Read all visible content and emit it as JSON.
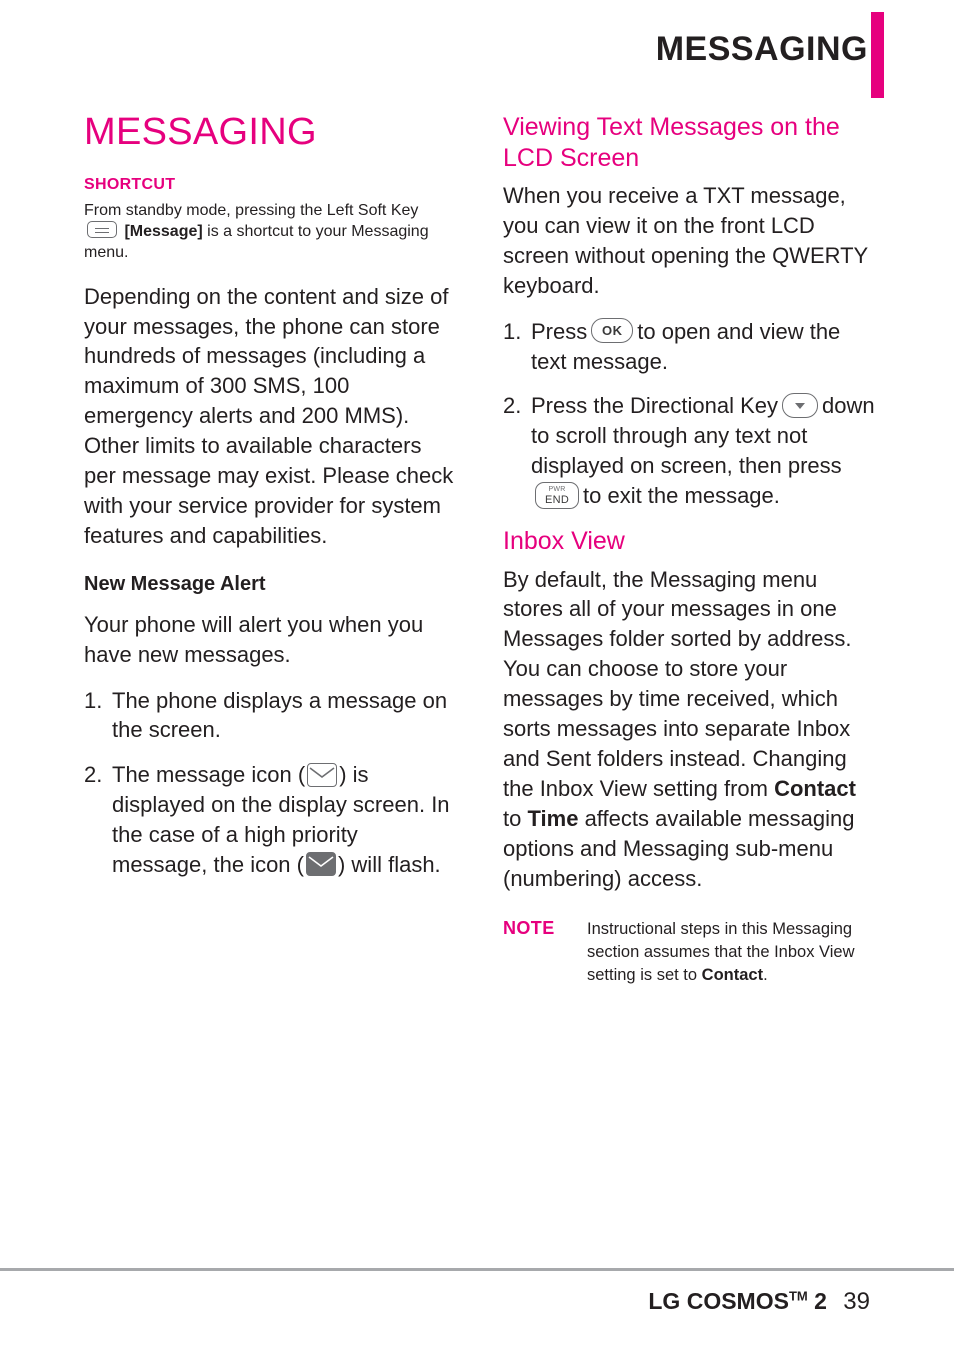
{
  "header": {
    "title": "MESSAGING",
    "accent_color": "#e6007e"
  },
  "left_column": {
    "page_title": "MESSAGING",
    "shortcut_heading": "SHORTCUT",
    "shortcut_text_part1": "From standby mode, pressing the Left Soft Key",
    "shortcut_text_bold": "[Message]",
    "shortcut_text_part2": "is a shortcut to your Messaging menu.",
    "paragraph_capacity": "Depending on the content and size of your messages, the phone can store hundreds of messages (including a maximum of 300 SMS, 100 emergency alerts and 200 MMS). Other limits to available characters per message may exist. Please check with your service provider for system features and capabilities.",
    "alert_heading": "New Message Alert",
    "alert_paragraph": "Your phone will alert you when you have new messages.",
    "steps": [
      {
        "number": "1.",
        "text": "The phone displays a message on the screen."
      },
      {
        "number": "2.",
        "text_part1": "The message icon (",
        "text_part2": ") is displayed on the display screen. In the case of a high priority message, the icon (",
        "text_part3": ") will flash."
      }
    ]
  },
  "right_column": {
    "section1_heading": "Viewing Text Messages on the LCD Screen",
    "section1_paragraph": "When you receive a TXT message, you can view it on the front LCD screen without opening the QWERTY keyboard.",
    "section1_steps": [
      {
        "number": "1.",
        "text_part1": "Press",
        "key_label": "OK",
        "text_part2": "to open and view the text message."
      },
      {
        "number": "2.",
        "text_part1": "Press the Directional Key",
        "text_part2": "down to scroll through any text not displayed on screen, then press",
        "key_line1": "PWR",
        "key_line2": "END",
        "text_part3": "to exit the message."
      }
    ],
    "section2_heading": "Inbox View",
    "section2_paragraph_part1": "By default, the Messaging menu stores all of your messages in one Messages folder sorted by address. You can choose to store your messages by time received, which sorts messages into separate Inbox and Sent folders instead. Changing the Inbox View setting from",
    "section2_bold1": "Contact",
    "section2_mid": "to",
    "section2_bold2": "Time",
    "section2_paragraph_part2": "affects available messaging options and Messaging sub-menu (numbering) access.",
    "note_label": "NOTE",
    "note_text_part1": "Instructional steps in this Messaging section assumes that the Inbox View setting is set to",
    "note_text_bold": "Contact",
    "note_text_end": "."
  },
  "footer": {
    "brand": "LG COSMOS",
    "trademark": "TM",
    "model": "2",
    "page_number": "39"
  }
}
